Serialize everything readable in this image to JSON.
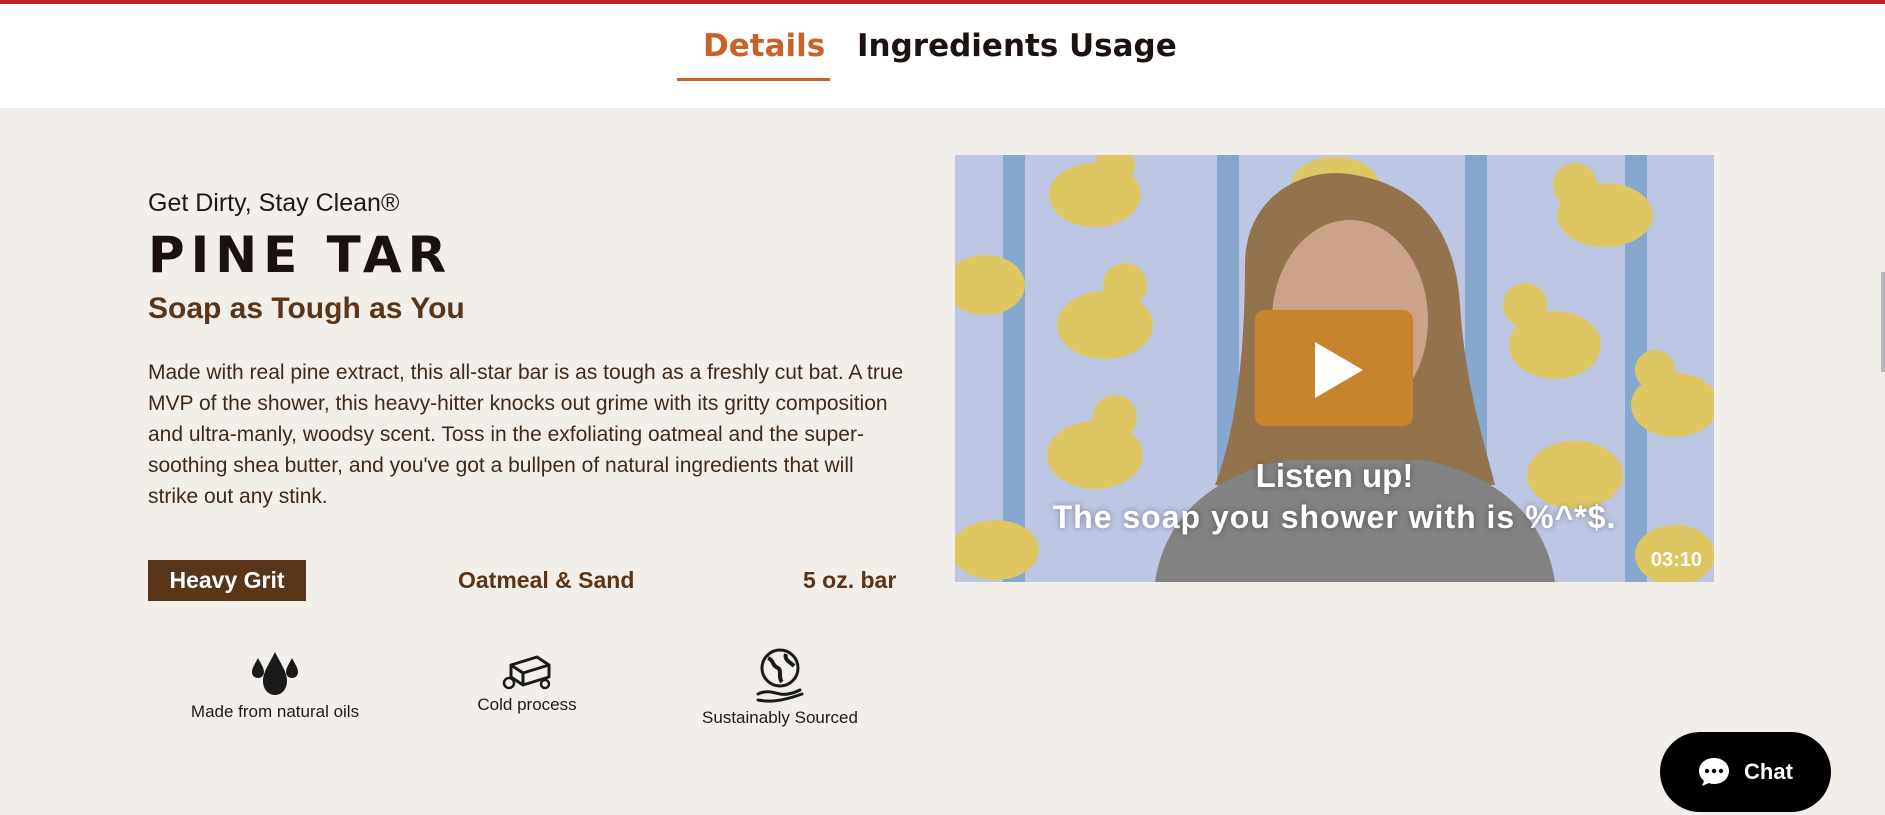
{
  "tabs": [
    {
      "label": "Details",
      "active": true
    },
    {
      "label": "Ingredients",
      "active": false
    },
    {
      "label": "Usage",
      "active": false
    }
  ],
  "product": {
    "tagline": "Get Dirty, Stay Clean®",
    "name": "PINE TAR",
    "subtitle": "Soap as Tough as You",
    "description": "Made with real pine extract, this all-star bar is as tough as a freshly cut bat. A true MVP of the shower, this heavy-hitter knocks out grime with its gritty composition and ultra-manly, woodsy scent. Toss in the exfoliating oatmeal and the super-soothing shea butter, and you've got a bullpen of natural ingredients that will strike out any stink.",
    "grit_badge": "Heavy Grit",
    "exfoliant": "Oatmeal & Sand",
    "size": "5 oz. bar"
  },
  "features": [
    {
      "icon": "water-drops-icon",
      "label": "Made from natural oils"
    },
    {
      "icon": "soap-bar-icon",
      "label": "Cold process"
    },
    {
      "icon": "globe-hand-icon",
      "label": "Sustainably Sourced"
    }
  ],
  "video": {
    "caption_line1": "Listen up!",
    "caption_line2": "The soap you shower with is %^*$.",
    "duration": "03:10"
  },
  "chat": {
    "label": "Chat"
  },
  "colors": {
    "accent": "#c8612a",
    "brown": "#5a3517",
    "play_button": "#c8832f",
    "top_line": "#c0252b",
    "page_bg": "#f2efeb"
  }
}
